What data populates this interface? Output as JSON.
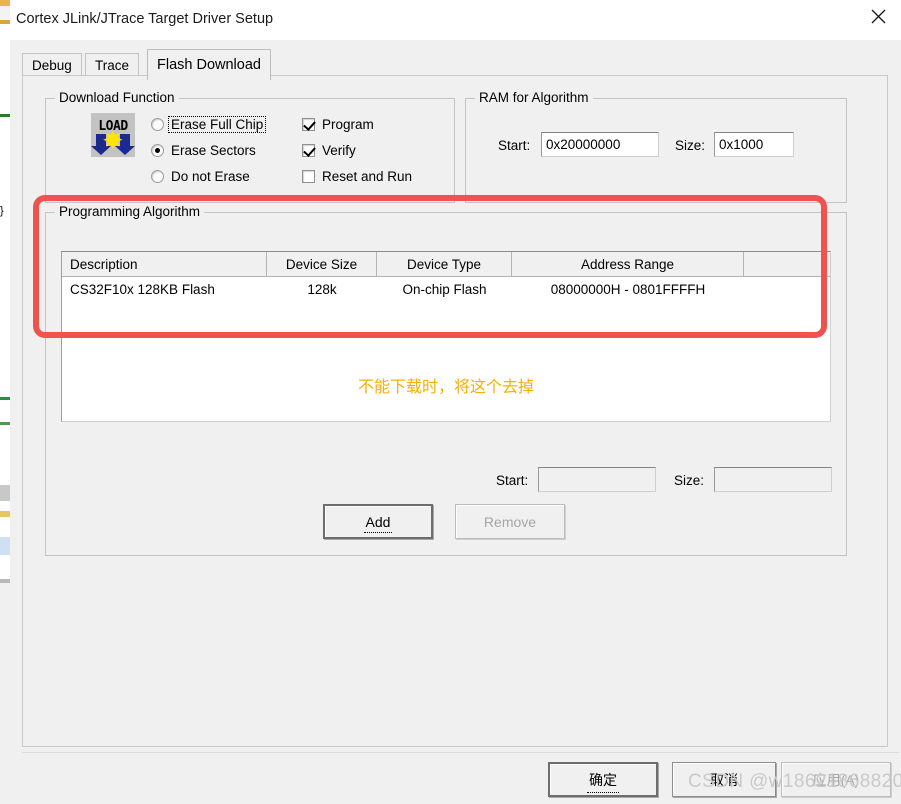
{
  "window": {
    "title": "Cortex JLink/JTrace Target Driver Setup",
    "close_icon": "close-icon"
  },
  "tabs": [
    {
      "label": "Debug",
      "selected": false
    },
    {
      "label": "Trace",
      "selected": false
    },
    {
      "label": "Flash Download",
      "selected": true
    }
  ],
  "download_function": {
    "title": "Download Function",
    "icon": "load-icon",
    "icon_text": "LOAD",
    "erase_options": [
      {
        "label": "Erase Full Chip",
        "checked": false,
        "focused": true
      },
      {
        "label": "Erase Sectors",
        "checked": true,
        "focused": false
      },
      {
        "label": "Do not Erase",
        "checked": false,
        "focused": false
      }
    ],
    "flags": [
      {
        "label": "Program",
        "checked": true
      },
      {
        "label": "Verify",
        "checked": true
      },
      {
        "label": "Reset and Run",
        "checked": false
      }
    ]
  },
  "ram_for_algorithm": {
    "title": "RAM for Algorithm",
    "start_label": "Start:",
    "start_value": "0x20000000",
    "size_label": "Size:",
    "size_value": "0x1000"
  },
  "programming_algorithm": {
    "title": "Programming Algorithm",
    "columns": [
      "Description",
      "Device Size",
      "Device Type",
      "Address Range",
      ""
    ],
    "rows": [
      {
        "description": "CS32F10x 128KB Flash",
        "device_size": "128k",
        "device_type": "On-chip Flash",
        "address_range": "08000000H - 0801FFFFH",
        "extra": ""
      }
    ],
    "annotation_note": "不能下载时，将这个去掉",
    "annotation_color": "#f5b100",
    "highlight_color": "#f0534e",
    "start_label": "Start:",
    "start_value": "",
    "size_label": "Size:",
    "size_value": ""
  },
  "list_buttons": {
    "add_label": "Add",
    "add_enabled": true,
    "remove_label": "Remove",
    "remove_enabled": false
  },
  "dialog_buttons": {
    "ok_label": "确定",
    "cancel_label": "取消",
    "apply_label": "应用(A)",
    "apply_enabled": false
  },
  "watermark": "CSDN @w18621868820"
}
